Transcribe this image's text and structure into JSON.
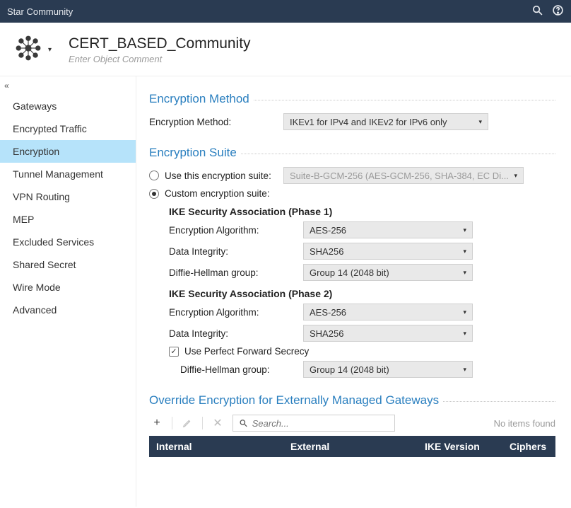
{
  "window": {
    "title": "Star Community"
  },
  "header": {
    "title": "CERT_BASED_Community",
    "comment_placeholder": "Enter Object Comment"
  },
  "sidebar": {
    "items": [
      {
        "label": "Gateways"
      },
      {
        "label": "Encrypted Traffic"
      },
      {
        "label": "Encryption",
        "selected": true
      },
      {
        "label": "Tunnel Management"
      },
      {
        "label": "VPN Routing"
      },
      {
        "label": "MEP"
      },
      {
        "label": "Excluded Services"
      },
      {
        "label": "Shared Secret"
      },
      {
        "label": "Wire Mode"
      },
      {
        "label": "Advanced"
      }
    ]
  },
  "sections": {
    "method": {
      "title": "Encryption Method",
      "label": "Encryption Method:",
      "value": "IKEv1 for IPv4 and IKEv2 for IPv6 only"
    },
    "suite": {
      "title": "Encryption Suite",
      "use_suite_label": "Use this encryption suite:",
      "use_suite_value": "Suite-B-GCM-256 (AES-GCM-256, SHA-384, EC Di...",
      "custom_label": "Custom encryption suite:",
      "phase1": {
        "title": "IKE Security Association (Phase 1)",
        "enc_label": "Encryption Algorithm:",
        "enc_value": "AES-256",
        "int_label": "Data Integrity:",
        "int_value": "SHA256",
        "dh_label": "Diffie-Hellman group:",
        "dh_value": "Group 14 (2048 bit)"
      },
      "phase2": {
        "title": "IKE Security Association (Phase 2)",
        "enc_label": "Encryption Algorithm:",
        "enc_value": "AES-256",
        "int_label": "Data Integrity:",
        "int_value": "SHA256",
        "pfs_label": "Use Perfect Forward Secrecy",
        "dh_label": "Diffie-Hellman group:",
        "dh_value": "Group 14 (2048 bit)"
      }
    },
    "override": {
      "title": "Override Encryption for Externally Managed Gateways",
      "search_placeholder": "Search...",
      "no_items": "No items found",
      "cols": {
        "internal": "Internal",
        "external": "External",
        "ike": "IKE Version",
        "ciphers": "Ciphers"
      }
    }
  }
}
